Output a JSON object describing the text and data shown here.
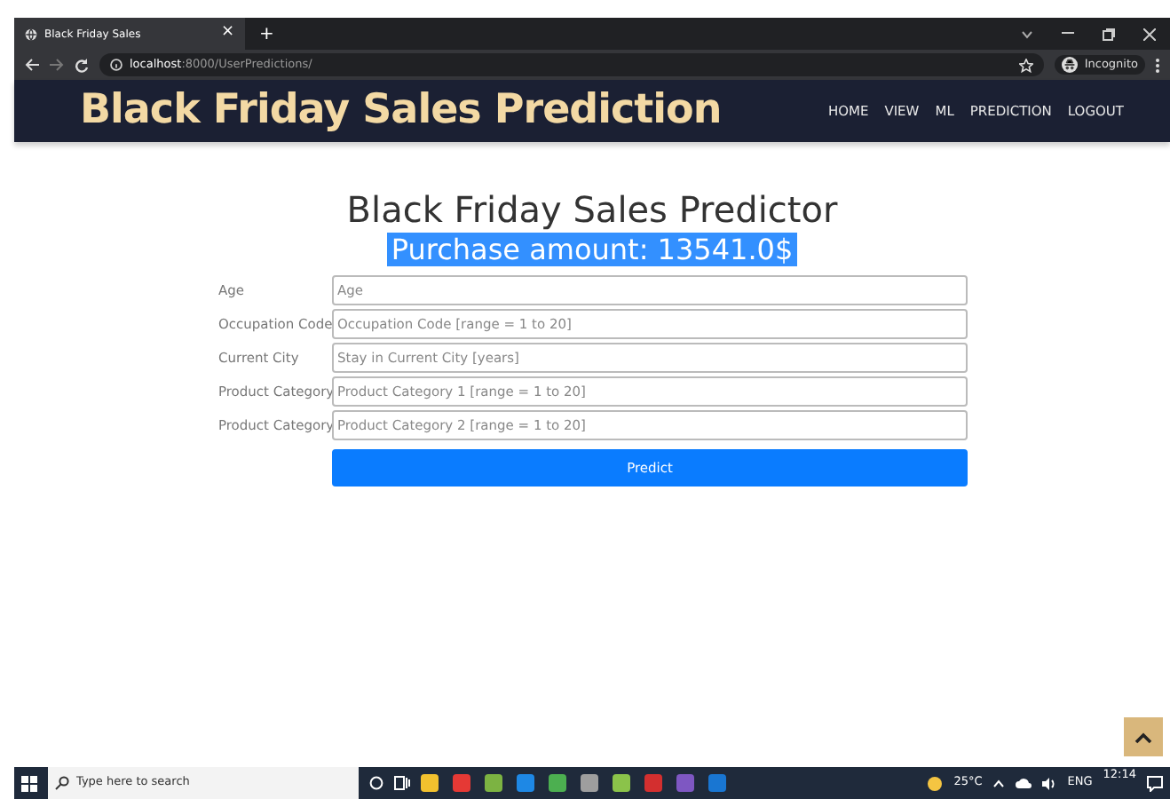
{
  "browser": {
    "tab_title": "Black Friday Sales",
    "tab_close": "×",
    "new_tab": "+",
    "url_host": "localhost",
    "url_rest": ":8000/UserPredictions/",
    "profile": "Incognito"
  },
  "navbar": {
    "brand": "Black Friday Sales Prediction",
    "links": [
      {
        "label": "HOME"
      },
      {
        "label": "VIEW"
      },
      {
        "label": "ML"
      },
      {
        "label": "PREDICTION"
      },
      {
        "label": "LOGOUT"
      }
    ]
  },
  "heading": "Black Friday Sales Predictor",
  "result": {
    "text": "Purchase amount: 13541.0$",
    "selected": true
  },
  "form": {
    "fields": [
      {
        "label": "Age",
        "placeholder": "Age"
      },
      {
        "label": "Occupation Code",
        "placeholder": "Occupation Code [range = 1 to 20]"
      },
      {
        "label": "Current City",
        "placeholder": "Stay in Current City [years]"
      },
      {
        "label": "Product Category",
        "placeholder": "Product Category 1 [range = 1 to 20]"
      },
      {
        "label": "Product Category",
        "placeholder": "Product Category 2 [range = 1 to 20]"
      }
    ],
    "submit": "Predict"
  },
  "taskbar": {
    "search_placeholder": "Type here to search",
    "weather": "25°C",
    "language": "ENG",
    "time": "12:14"
  }
}
